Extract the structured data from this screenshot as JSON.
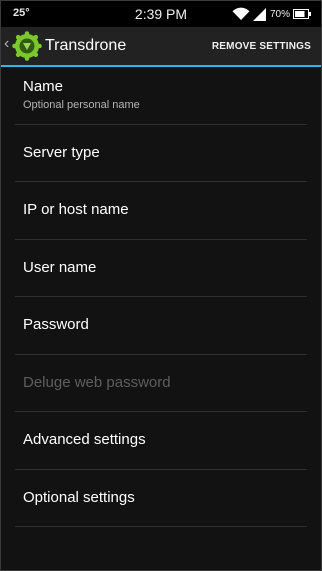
{
  "status_bar": {
    "temperature": "25°",
    "time": "2:39 PM",
    "battery_percent": "70%",
    "icons": [
      "wifi-icon",
      "signal-icon",
      "battery-icon"
    ]
  },
  "action_bar": {
    "title": "Transdrone",
    "remove_settings_label": "REMOVE SETTINGS",
    "accent_color": "#33b5e5",
    "icons": [
      "up-caret-icon",
      "transdrone-app-icon"
    ]
  },
  "settings": {
    "items": [
      {
        "label": "Name",
        "summary": "Optional personal name",
        "enabled": true
      },
      {
        "label": "Server type",
        "enabled": true
      },
      {
        "label": "IP or host name",
        "enabled": true
      },
      {
        "label": "User name",
        "enabled": true
      },
      {
        "label": "Password",
        "enabled": true
      },
      {
        "label": "Deluge web password",
        "enabled": false
      },
      {
        "label": "Advanced settings",
        "enabled": true
      },
      {
        "label": "Optional settings",
        "enabled": true
      }
    ]
  }
}
